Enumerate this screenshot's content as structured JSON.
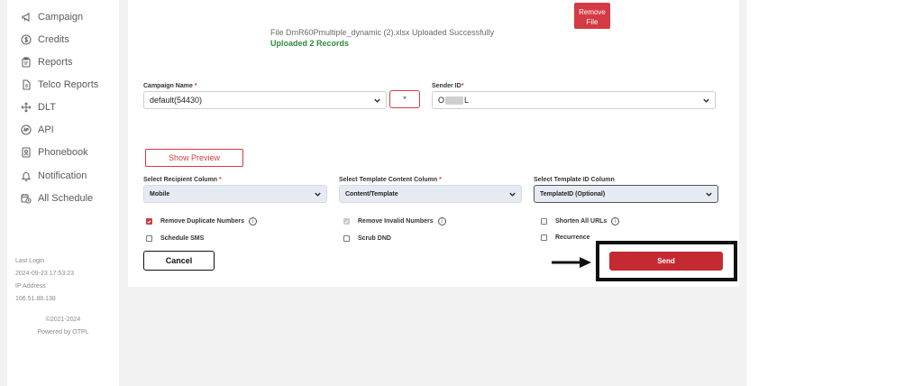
{
  "sidebar": {
    "items": [
      {
        "label": "Campaign",
        "icon": "megaphone-icon"
      },
      {
        "label": "Credits",
        "icon": "dollar-circle-icon"
      },
      {
        "label": "Reports",
        "icon": "clipboard-icon"
      },
      {
        "label": "Telco Reports",
        "icon": "document-icon"
      },
      {
        "label": "DLT",
        "icon": "move-arrows-icon"
      },
      {
        "label": "API",
        "icon": "api-icon"
      },
      {
        "label": "Phonebook",
        "icon": "contact-book-icon"
      },
      {
        "label": "Notification",
        "icon": "bell-icon"
      },
      {
        "label": "All Schedule",
        "icon": "calendar-clock-icon"
      }
    ],
    "last_login_label": "Last Login",
    "last_login_value": "2024-09-23 17:53:23",
    "ip_label": "IP Address",
    "ip_value": "106.51.88.138",
    "copyright": "©2021-2024",
    "powered_by": "Powered by OTPL"
  },
  "upload": {
    "remove_file_label": "Remove\nFile",
    "message": "File DmR60Pmultiple_dynamic (2).xlsx Uploaded Successfully",
    "records": "Uploaded 2 Records"
  },
  "form": {
    "campaign_name_label": "Campaign Name",
    "campaign_name_value": "default(54430)",
    "star_button_label": "*",
    "sender_id_label": "Sender ID",
    "sender_id_prefix": "O",
    "sender_id_suffix": "L",
    "show_preview_label": "Show Preview",
    "recipient_column_label": "Select Recipient Column",
    "recipient_column_value": "Mobile",
    "template_content_label": "Select Template Content Column",
    "template_content_value": "Content/Template",
    "template_id_label": "Select Template ID Column",
    "template_id_value": "TemplateID (Optional)",
    "required_mark": "*"
  },
  "options": {
    "remove_duplicates": {
      "label": "Remove Duplicate Numbers",
      "checked": true
    },
    "remove_invalid": {
      "label": "Remove Invalid Numbers",
      "checked": true,
      "disabled": true
    },
    "shorten_urls": {
      "label": "Shorten All URLs",
      "checked": false
    },
    "schedule_sms": {
      "label": "Schedule SMS",
      "checked": false
    },
    "scrub_dnd": {
      "label": "Scrub DND",
      "checked": false
    },
    "recurrence": {
      "label": "Recurrence",
      "checked": false
    },
    "info_glyph": "i"
  },
  "actions": {
    "cancel_label": "Cancel",
    "send_label": "Send"
  },
  "colors": {
    "accent": "#d43a43",
    "send": "#c52a33",
    "success": "#2e8b3d",
    "select_fill": "#e5eaf3"
  }
}
